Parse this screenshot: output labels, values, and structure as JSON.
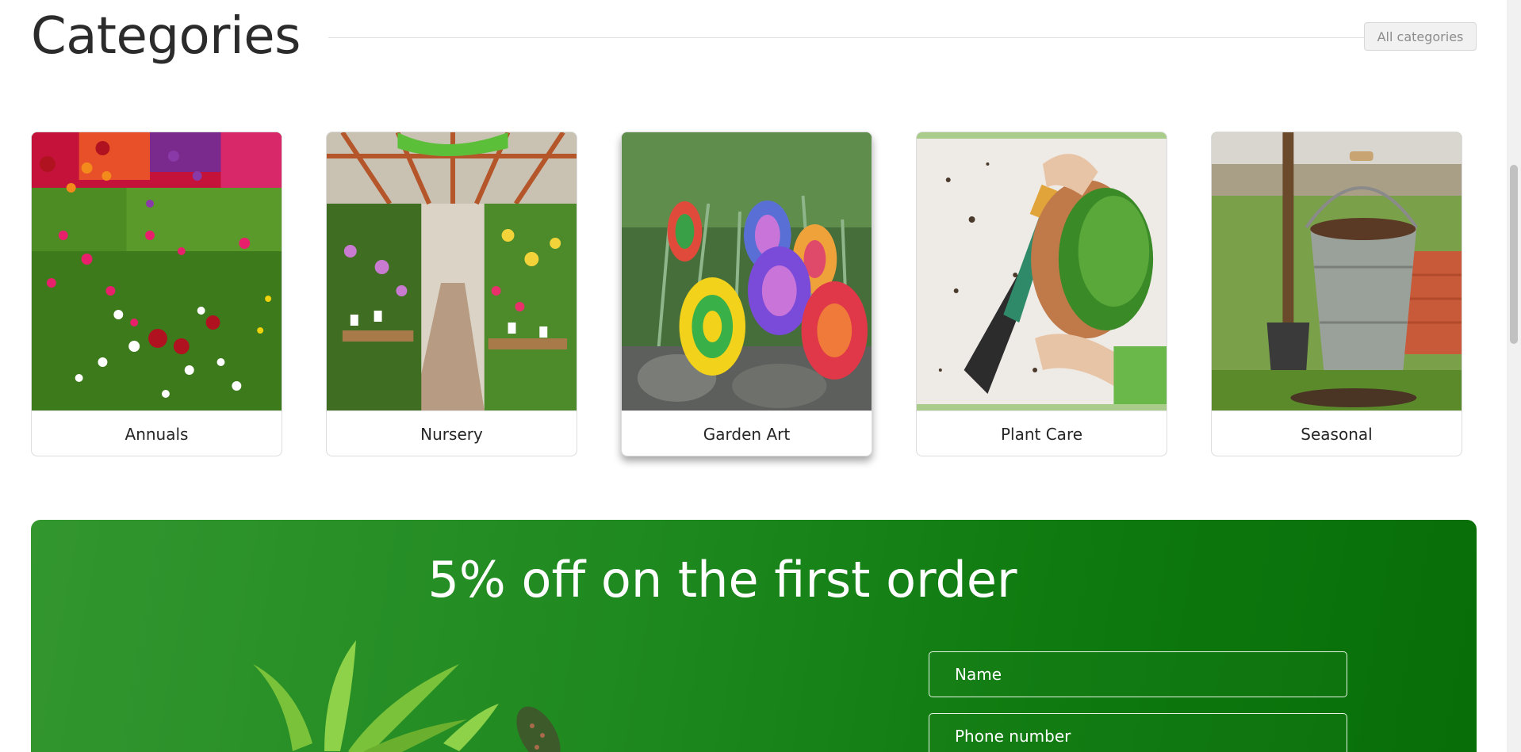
{
  "categories_section": {
    "title": "Categories",
    "all_button_label": "All categories",
    "cards": [
      {
        "label": "Annuals",
        "image": "flower-bed-photo"
      },
      {
        "label": "Nursery",
        "image": "greenhouse-photo"
      },
      {
        "label": "Garden Art",
        "image": "painted-snail-stones-photo",
        "highlighted": true
      },
      {
        "label": "Plant Care",
        "image": "potting-plant-photo"
      },
      {
        "label": "Seasonal",
        "image": "bucket-and-shovel-photo"
      }
    ]
  },
  "promo": {
    "title": "5% off on the first order",
    "name_placeholder": "Name",
    "phone_placeholder": "Phone number",
    "accent_color": "#1f8a20"
  }
}
